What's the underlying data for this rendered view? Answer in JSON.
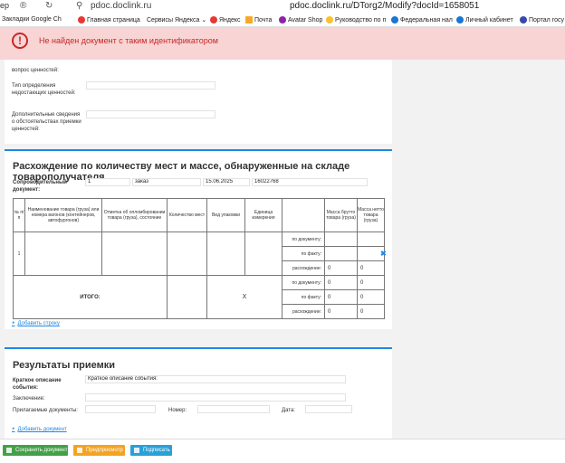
{
  "browser": {
    "tab_fragment": "ер",
    "host": "pdoc.doclink.ru",
    "url": "pdoc.doclink.ru/DTorg2/Modify?docId=1658051"
  },
  "bookmarks": [
    {
      "label": "Закладки Google Ch",
      "color": "#4285f4"
    },
    {
      "label": "Главная страница",
      "color": "#e53935"
    },
    {
      "label": "Сервисы Яндекса",
      "color": "#f2f2f2"
    },
    {
      "label": "Яндекс",
      "color": "#e53935"
    },
    {
      "label": "Почта",
      "color": "#f9a825"
    },
    {
      "label": "Avatar Shop",
      "color": "#8e24aa"
    },
    {
      "label": "Руководство по п",
      "color": "#fbc02d"
    },
    {
      "label": "Федеральная нал",
      "color": "#1976d2"
    },
    {
      "label": "Личный кабинет",
      "color": "#1976d2"
    },
    {
      "label": "Портал госу",
      "color": "#3949ab"
    }
  ],
  "alert": {
    "message": "Не найден документ с таким идентификатором",
    "color": "#c62828"
  },
  "section_top": {
    "trunc_label": "вопрос ценностей:",
    "type_label": "Тип определения недостающих ценностей:",
    "extra_label": "Дополнительные сведения о обстоятельствах приемки ценностей:"
  },
  "discrepancy": {
    "title": "Расхождение по количеству мест и массе, обнаруженные на складе товарополучателя",
    "accompany_label": "Сопроводительный документ:",
    "doc_number": "1",
    "doc_type": "заказ",
    "doc_date": "15.06.2025",
    "doc_extra": "16022768",
    "headers": {
      "num": "№ п/п",
      "name": "Наименование товара (груза) или номера вагонов (контейнеров, автофургонов)",
      "seal": "Отметка об опломбировании товара (груза), состояние",
      "qty": "Количество мест",
      "pack": "Вид упаковки",
      "unit": "Единица измерения",
      "gross": "Масса брутто товара (груза)",
      "net": "Масса нетто товара (груза)"
    },
    "row_num": "1",
    "row_labels": [
      "по документу:",
      "по факту:",
      "расхождение:"
    ],
    "row_values": {
      "gross": [
        "",
        "",
        "0"
      ],
      "net": [
        "",
        "",
        "0"
      ]
    },
    "total_label": "ИТОГО:",
    "total_x": "X",
    "total_values": {
      "gross": [
        "0",
        "0",
        "0"
      ],
      "net": [
        "0",
        "0",
        "0"
      ]
    },
    "delete_icon": "✖",
    "add_row": "Добавить строку"
  },
  "results": {
    "title": "Результаты приемки",
    "short_desc_label": "Краткое описание события:",
    "short_desc_value": "Краткое описание события:",
    "conclusion_label": "Заключение:",
    "attached_label": "Прилагаемые документы:",
    "number_label": "Номер:",
    "date_label": "Дата:",
    "add_doc": "Добавить документ"
  },
  "footer": {
    "save": "Сохранить документ",
    "preview": "Предпросмотр",
    "sign": "Подписать",
    "colors": {
      "save": "#43a047",
      "preview": "#f4a321",
      "sign": "#29a0d8"
    }
  }
}
